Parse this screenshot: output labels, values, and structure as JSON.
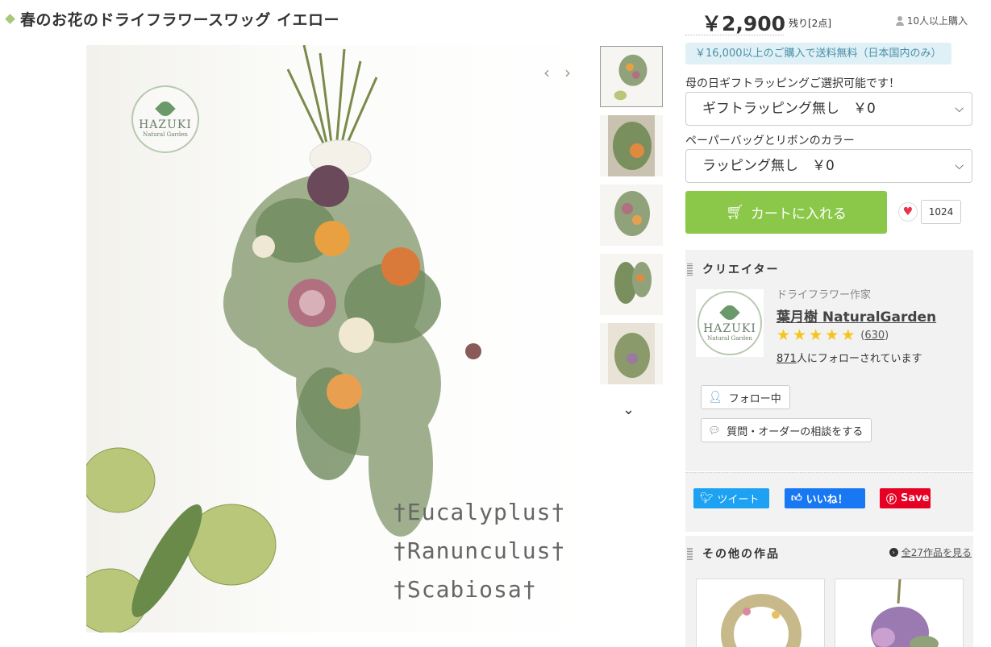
{
  "title": "春のお花のドライフラワースワッグ イエロー",
  "image": {
    "logo_text": "HAZUKI",
    "logo_sub": "Natural Garden",
    "latin_lines": [
      "†Eucalyplus†",
      "†Ranunculus†",
      "†Scabiosa†"
    ]
  },
  "price": "￥2,900",
  "stock": "残り[2点]",
  "buyers": "10人以上購入",
  "shipping_notice": "￥16,000以上のご購入で送料無料（日本国内のみ）",
  "gift": {
    "label": "母の日ギフトラッピングご選択可能です！",
    "selected": "ギフトラッピング無し　￥0"
  },
  "wrap": {
    "label": "ペーパーバッグとリボンのカラー",
    "selected": "ラッピング無し　￥0"
  },
  "cart_button": "カートに入れる",
  "like_count": "1024",
  "creator": {
    "heading": "クリエイター",
    "role": "ドライフラワー作家",
    "name": "葉月樹 NaturalGarden",
    "rating_stars": 5,
    "review_count": "630",
    "followers_count": "871",
    "followers_suffix": "人にフォローされています",
    "follow_button": "フォロー中",
    "inquiry_button": "質問・オーダーの相談をする"
  },
  "social": {
    "tweet": "ツイート",
    "like": "いいね！",
    "save": "Save"
  },
  "others": {
    "heading": "その他の作品",
    "see_all": "全27作品を見る"
  },
  "colors": {
    "accent_green": "#8bc84a",
    "shipping_bg": "#dff0f6",
    "heart": "#e8344a"
  }
}
